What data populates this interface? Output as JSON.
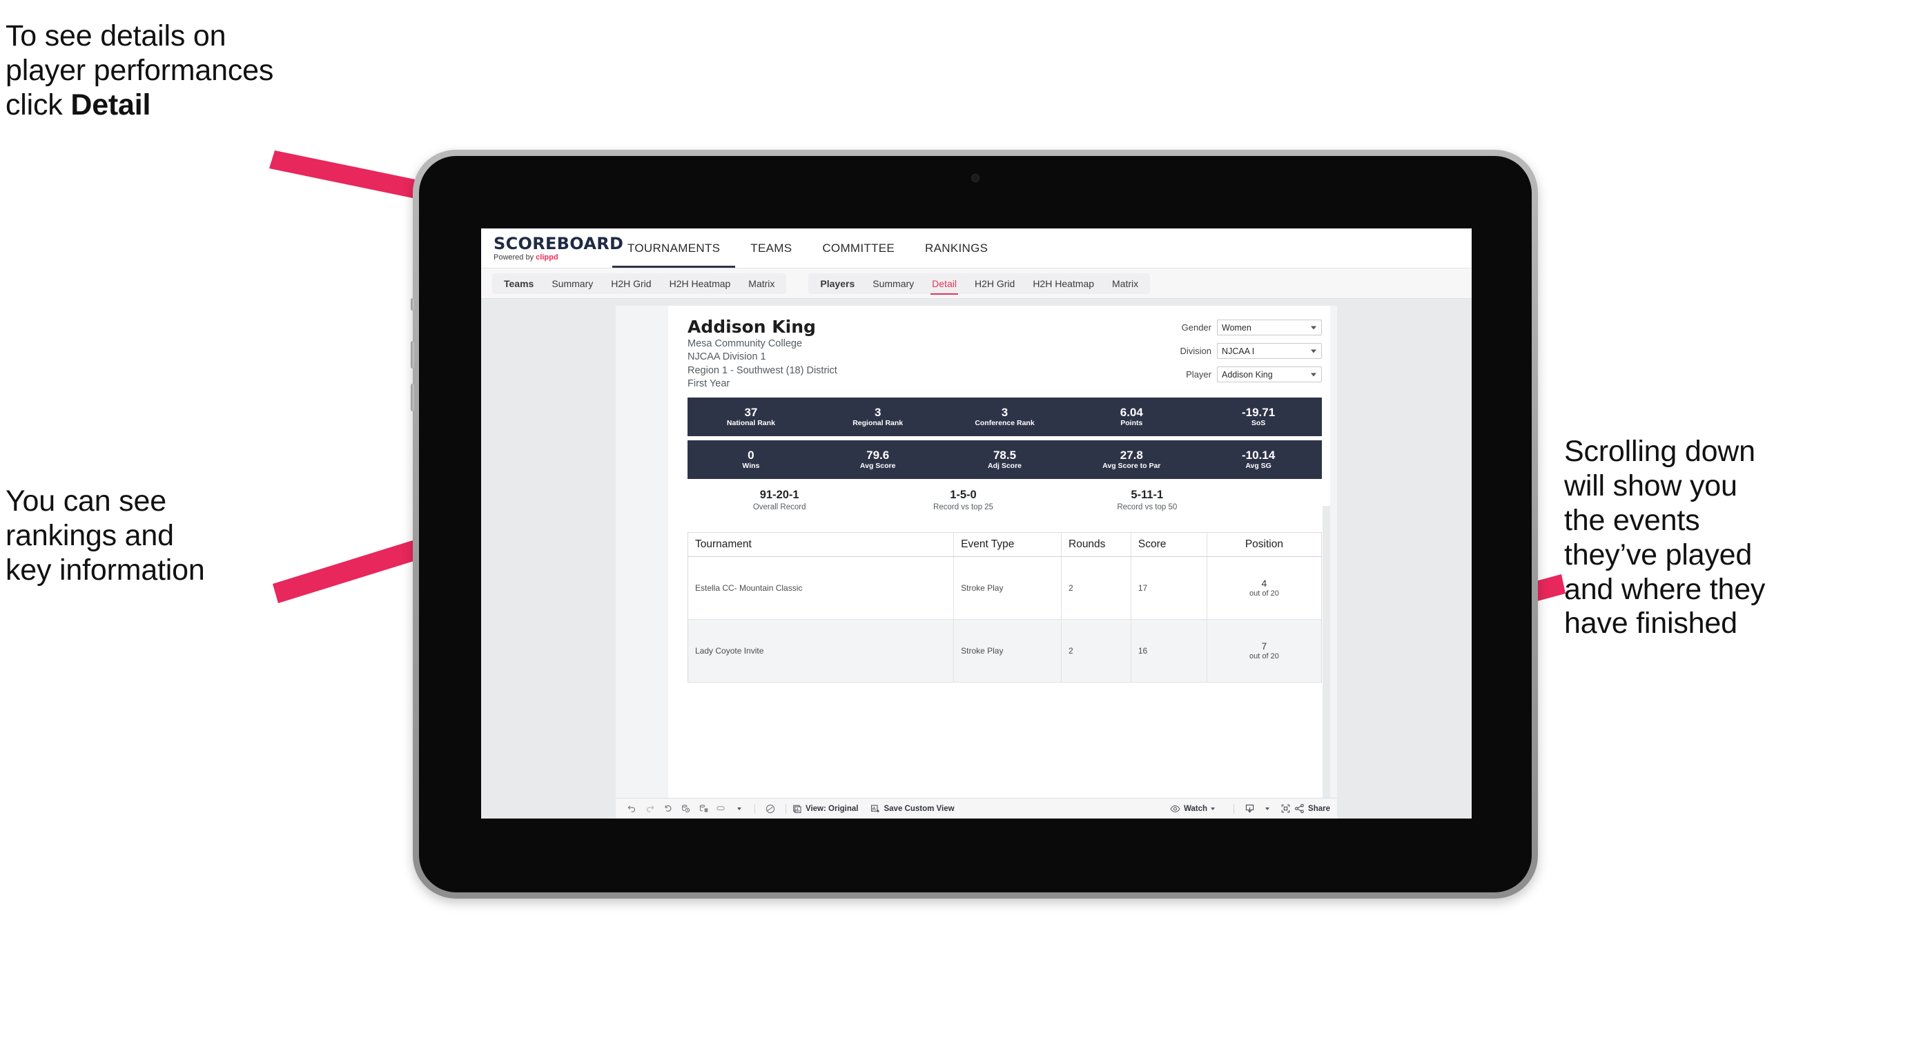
{
  "annotations": {
    "top_left": "To see details on\nplayer performances\nclick ",
    "top_left_bold": "Detail",
    "mid_left": "You can see\nrankings and\nkey information",
    "right": "Scrolling down\nwill show you\nthe events\nthey’ve played\nand where they\nhave finished"
  },
  "colors": {
    "accent_pink": "#ef2b58",
    "arrow_pink": "#e8275c",
    "dark_navy": "#2e3448",
    "tab_active": "#e3365c"
  },
  "app": {
    "logo": {
      "main": "SCOREBOARD",
      "powered_prefix": "Powered by ",
      "brand": "clippd"
    },
    "main_nav": [
      {
        "label": "TOURNAMENTS",
        "active": true
      },
      {
        "label": "TEAMS",
        "active": false
      },
      {
        "label": "COMMITTEE",
        "active": false
      },
      {
        "label": "RANKINGS",
        "active": false
      }
    ],
    "sub_nav": {
      "teams_group": [
        {
          "label": "Teams",
          "head": true,
          "selected": false
        },
        {
          "label": "Summary",
          "head": false,
          "selected": false
        },
        {
          "label": "H2H Grid",
          "head": false,
          "selected": false
        },
        {
          "label": "H2H Heatmap",
          "head": false,
          "selected": false
        },
        {
          "label": "Matrix",
          "head": false,
          "selected": false
        }
      ],
      "players_group": [
        {
          "label": "Players",
          "head": true,
          "selected": false
        },
        {
          "label": "Summary",
          "head": false,
          "selected": false
        },
        {
          "label": "Detail",
          "head": false,
          "selected": true
        },
        {
          "label": "H2H Grid",
          "head": false,
          "selected": false
        },
        {
          "label": "H2H Heatmap",
          "head": false,
          "selected": false
        },
        {
          "label": "Matrix",
          "head": false,
          "selected": false
        }
      ]
    }
  },
  "player": {
    "name": "Addison King",
    "school": "Mesa Community College",
    "division": "NJCAA Division 1",
    "region": "Region 1 - Southwest (18) District",
    "year": "First Year"
  },
  "filters": [
    {
      "label": "Gender",
      "value": "Women"
    },
    {
      "label": "Division",
      "value": "NJCAA I"
    },
    {
      "label": "Player",
      "value": "Addison King"
    }
  ],
  "stats_row_1": [
    {
      "value": "37",
      "label": "National Rank"
    },
    {
      "value": "3",
      "label": "Regional Rank"
    },
    {
      "value": "3",
      "label": "Conference Rank"
    },
    {
      "value": "6.04",
      "label": "Points"
    },
    {
      "value": "-19.71",
      "label": "SoS"
    }
  ],
  "stats_row_2": [
    {
      "value": "0",
      "label": "Wins"
    },
    {
      "value": "79.6",
      "label": "Avg Score"
    },
    {
      "value": "78.5",
      "label": "Adj Score"
    },
    {
      "value": "27.8",
      "label": "Avg Score to Par"
    },
    {
      "value": "-10.14",
      "label": "Avg SG"
    }
  ],
  "records": [
    {
      "value": "91-20-1",
      "label": "Overall Record"
    },
    {
      "value": "1-5-0",
      "label": "Record vs top 25"
    },
    {
      "value": "5-11-1",
      "label": "Record vs top 50"
    }
  ],
  "tournament_table": {
    "headers": [
      "Tournament",
      "Event Type",
      "Rounds",
      "Score",
      "Position"
    ],
    "rows": [
      {
        "tournament": "Estella CC- Mountain Classic",
        "event_type": "Stroke Play",
        "rounds": "2",
        "score": "17",
        "position_num": "4",
        "position_sub": "out of 20"
      },
      {
        "tournament": "Lady Coyote Invite",
        "event_type": "Stroke Play",
        "rounds": "2",
        "score": "16",
        "position_num": "7",
        "position_sub": "out of 20"
      }
    ]
  },
  "toolbar": {
    "view_label": "View: Original",
    "save_view_label": "Save Custom View",
    "watch_label": "Watch",
    "share_label": "Share"
  }
}
